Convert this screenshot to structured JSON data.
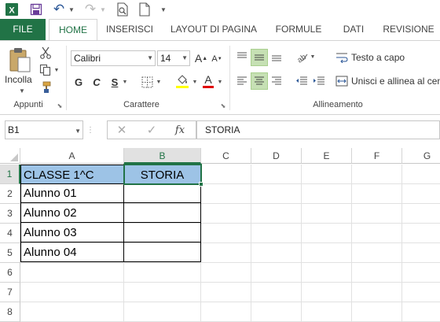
{
  "qat": {
    "undo_label": "↶",
    "redo_label": "↷"
  },
  "tabs": [
    {
      "label": "FILE"
    },
    {
      "label": "HOME"
    },
    {
      "label": "INSERISCI"
    },
    {
      "label": "LAYOUT DI PAGINA"
    },
    {
      "label": "FORMULE"
    },
    {
      "label": "DATI"
    },
    {
      "label": "REVISIONE"
    }
  ],
  "ribbon": {
    "clipboard": {
      "paste_label": "Incolla",
      "group_label": "Appunti"
    },
    "font": {
      "family": "Calibri",
      "size": "14",
      "bold": "G",
      "italic": "C",
      "underline": "S",
      "grow": "A",
      "shrink": "A",
      "font_color_glyph": "A",
      "group_label": "Carattere"
    },
    "alignment": {
      "wrap_label": "Testo a capo",
      "merge_label": "Unisci e allinea al centro",
      "group_label": "Allineamento"
    }
  },
  "formula_bar": {
    "name_box": "B1",
    "fx": "fx",
    "content": "STORIA"
  },
  "sheet": {
    "columns": [
      "A",
      "B",
      "C",
      "D",
      "E",
      "F",
      "G"
    ],
    "selected_column": "B",
    "rows": [
      "1",
      "2",
      "3",
      "4",
      "5",
      "6",
      "7",
      "8"
    ],
    "selected_row": "1",
    "cells": {
      "A1": "CLASSE 1^C",
      "B1": "STORIA",
      "A2": "Alunno 01",
      "A3": "Alunno 02",
      "A4": "Alunno 03",
      "A5": "Alunno 04"
    }
  },
  "colors": {
    "excel_green": "#217346",
    "header_fill": "#9dc3e6",
    "selection": "#217346"
  }
}
